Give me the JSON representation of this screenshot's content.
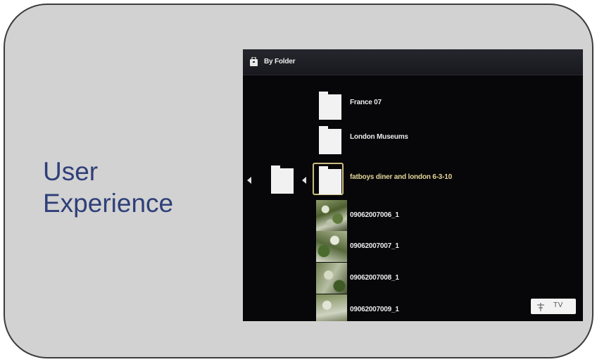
{
  "slide": {
    "title_lines": [
      "User",
      "Experience"
    ],
    "colors": {
      "title": "#2f3f79",
      "card": "#d2d2d2",
      "border": "#3c3c3c"
    }
  },
  "tv_ui": {
    "header": {
      "icon": "folder-bag-icon",
      "title": "By Folder"
    },
    "items": [
      {
        "type": "folder",
        "label": "France 07"
      },
      {
        "type": "folder",
        "label": "London Museums"
      },
      {
        "type": "folder",
        "label": "fatboys diner and london 6-3-10",
        "selected": true
      },
      {
        "type": "photo",
        "label": "09062007006_1"
      },
      {
        "type": "photo",
        "label": "09062007007_1"
      },
      {
        "type": "photo",
        "label": "09062007008_1"
      },
      {
        "type": "photo",
        "label": "09062007009_1"
      }
    ],
    "source_badge": {
      "icon": "antenna-icon",
      "label": "TV"
    },
    "colors": {
      "selected_text": "#e3d599",
      "selected_ring": "#cdbd7f",
      "background": "#070709"
    }
  }
}
